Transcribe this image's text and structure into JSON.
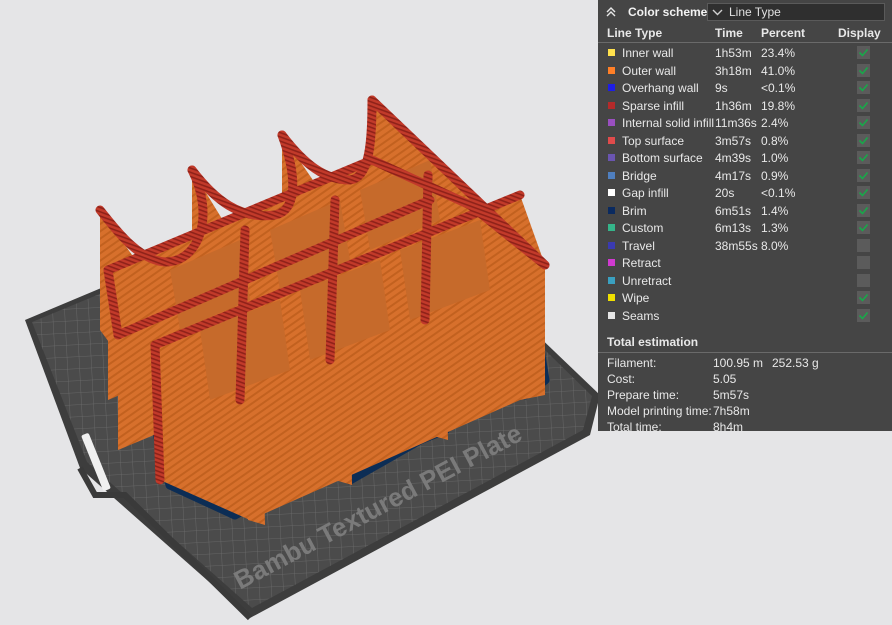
{
  "viewport": {
    "plate_label": "Bambu Textured PEI Plate",
    "colors": {
      "background": "#e5e5e7",
      "plate": "#4a4a4a",
      "outer_wall": "#d9742f",
      "sparse_infill": "#b5332b",
      "brim": "#0c2d55"
    }
  },
  "legend": {
    "title": "Color scheme",
    "scheme_select": "Line Type",
    "headers": {
      "type": "Line Type",
      "time": "Time",
      "percent": "Percent",
      "display": "Display"
    },
    "rows": [
      {
        "name": "Inner wall",
        "time": "1h53m",
        "percent": "23.4%",
        "color": "#ffe14d",
        "display": true
      },
      {
        "name": "Outer wall",
        "time": "3h18m",
        "percent": "41.0%",
        "color": "#ff7f27",
        "display": true
      },
      {
        "name": "Overhang wall",
        "time": "9s",
        "percent": "<0.1%",
        "color": "#1e1ee6",
        "display": true
      },
      {
        "name": "Sparse infill",
        "time": "1h36m",
        "percent": "19.8%",
        "color": "#b42a2a",
        "display": true
      },
      {
        "name": "Internal solid infill",
        "time": "11m36s",
        "percent": "2.4%",
        "color": "#9a4fc0",
        "display": true
      },
      {
        "name": "Top surface",
        "time": "3m57s",
        "percent": "0.8%",
        "color": "#e04b4b",
        "display": true
      },
      {
        "name": "Bottom surface",
        "time": "4m39s",
        "percent": "1.0%",
        "color": "#6a55b0",
        "display": true
      },
      {
        "name": "Bridge",
        "time": "4m17s",
        "percent": "0.9%",
        "color": "#4f7fbf",
        "display": true
      },
      {
        "name": "Gap infill",
        "time": "20s",
        "percent": "<0.1%",
        "color": "#ffffff",
        "display": true
      },
      {
        "name": "Brim",
        "time": "6m51s",
        "percent": "1.4%",
        "color": "#0a2a60",
        "display": true
      },
      {
        "name": "Custom",
        "time": "6m13s",
        "percent": "1.3%",
        "color": "#35b58a",
        "display": true
      },
      {
        "name": "Travel",
        "time": "38m55s",
        "percent": "8.0%",
        "color": "#3a3ab0",
        "display": false
      },
      {
        "name": "Retract",
        "time": "",
        "percent": "",
        "color": "#d03ad0",
        "display": false
      },
      {
        "name": "Unretract",
        "time": "",
        "percent": "",
        "color": "#3aa0c0",
        "display": false
      },
      {
        "name": "Wipe",
        "time": "",
        "percent": "",
        "color": "#f0e000",
        "display": true
      },
      {
        "name": "Seams",
        "time": "",
        "percent": "",
        "color": "#e6e6e6",
        "display": true
      }
    ],
    "estimation": {
      "title": "Total estimation",
      "filament_label": "Filament:",
      "filament_length": "100.95 m",
      "filament_weight": "252.53 g",
      "cost_label": "Cost:",
      "cost": "5.05",
      "prepare_label": "Prepare time:",
      "prepare": "5m57s",
      "model_label": "Model printing time:",
      "model": "7h58m",
      "total_label": "Total time:",
      "total": "8h4m"
    }
  }
}
